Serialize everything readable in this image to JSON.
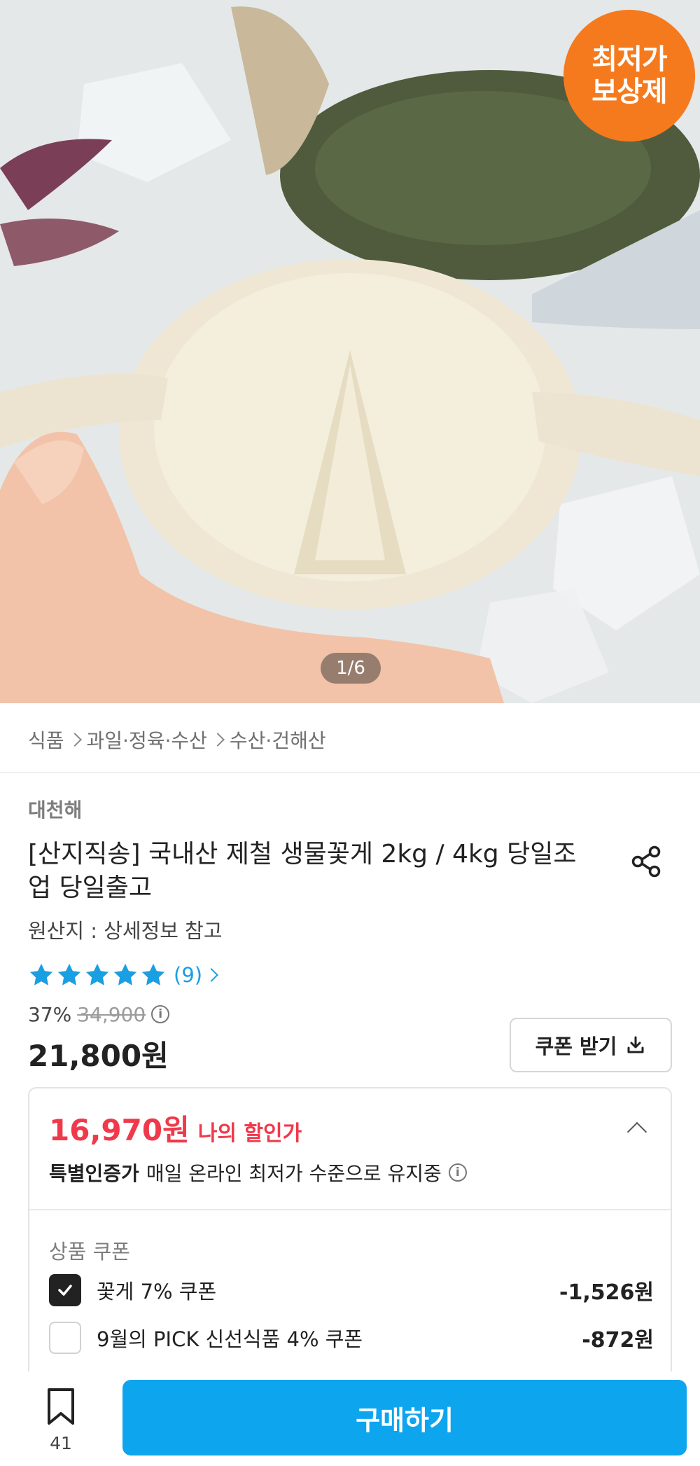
{
  "product_image": {
    "badge_text": "최저가 보상제",
    "counter": "1/6",
    "badge_color": "#f57a1e"
  },
  "breadcrumb": [
    "식품",
    "과일·정육·수산",
    "수산·건해산"
  ],
  "seller": "대천해",
  "title": "[산지직송] 국내산 제철 생물꽃게 2kg / 4kg 당일조업 당일출고",
  "origin": "원산지 : 상세정보 참고",
  "rating": {
    "stars": 5,
    "count": "(9)"
  },
  "price": {
    "discount_rate": "37%",
    "original": "34,900",
    "sale": "21,800원"
  },
  "coupon_button": {
    "label": "쿠폰 받기"
  },
  "my_discount": {
    "amount": "16,970원",
    "label": "나의 할인가",
    "cert_bold": "특별인증가",
    "cert_text": "매일 온라인 최저가 수준으로 유지중"
  },
  "coupons": {
    "title": "상품 쿠폰",
    "items": [
      {
        "name": "꽃게 7% 쿠폰",
        "value": "-1,526원",
        "checked": true
      },
      {
        "name": "9월의 PICK 신선식품 4% 쿠폰",
        "value": "-872원",
        "checked": false
      }
    ]
  },
  "bottom_bar": {
    "bookmark_count": "41",
    "buy_label": "구매하기"
  },
  "colors": {
    "accent": "#0ea5ef",
    "star": "#1a9fe3",
    "discount": "#f0394b"
  }
}
